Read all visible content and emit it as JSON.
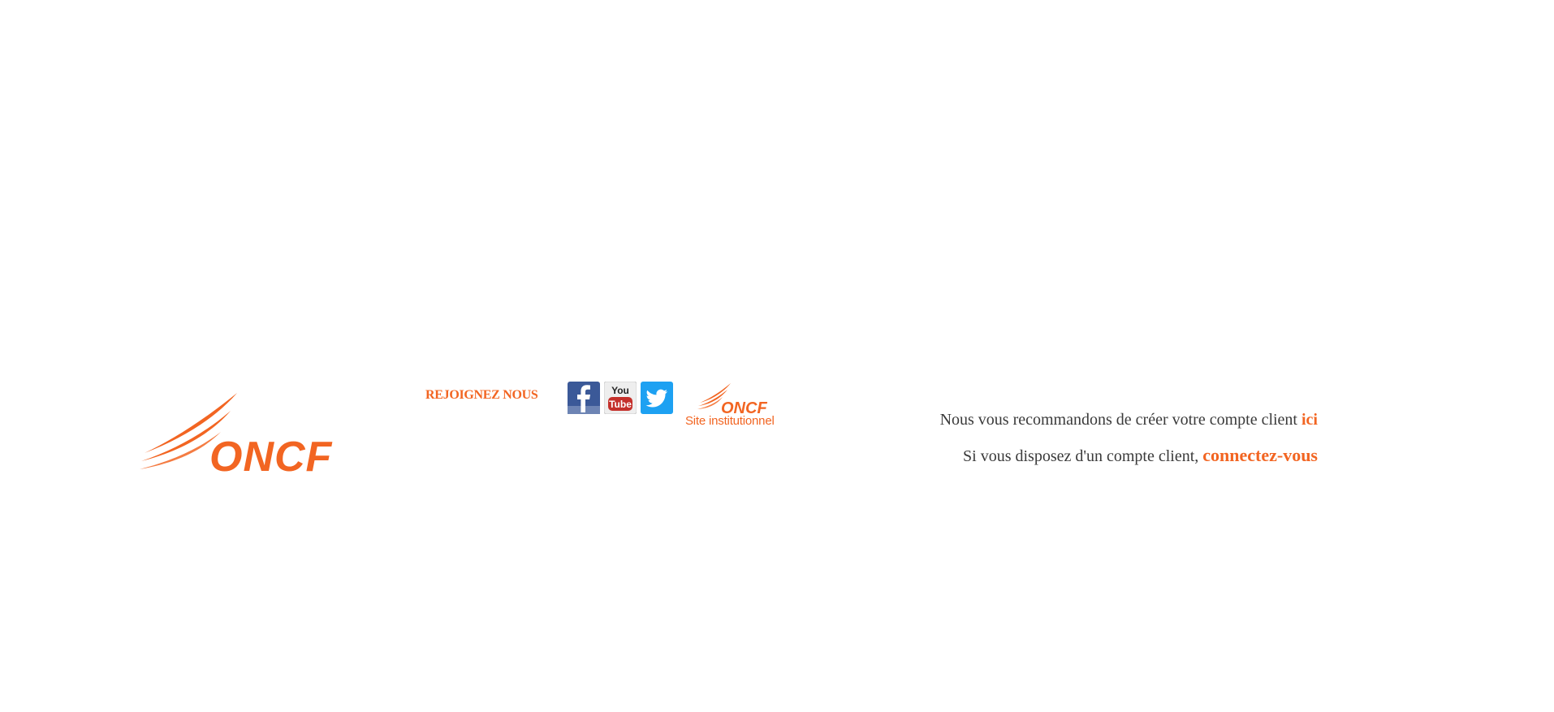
{
  "header": {
    "logo_text": "ONCF",
    "join_label": "REJOIGNEZ NOUS",
    "social": [
      {
        "name": "facebook",
        "icon": "facebook-icon",
        "color": "#3b5998"
      },
      {
        "name": "youtube",
        "icon": "youtube-icon",
        "color": "#c4302b"
      },
      {
        "name": "twitter",
        "icon": "twitter-icon",
        "color": "#1da1f2"
      }
    ],
    "institutional": {
      "logo_text": "ONCF",
      "caption": "Site institutionnel"
    }
  },
  "account": {
    "create_text": "Nous vous recommandons de créer votre compte client ",
    "create_link": "ici",
    "login_text": "Si vous disposez d'un compte client, ",
    "login_link": "connectez-vous"
  },
  "colors": {
    "brand": "#f26522",
    "text": "#3a3a3a",
    "background": "#ffffff"
  }
}
